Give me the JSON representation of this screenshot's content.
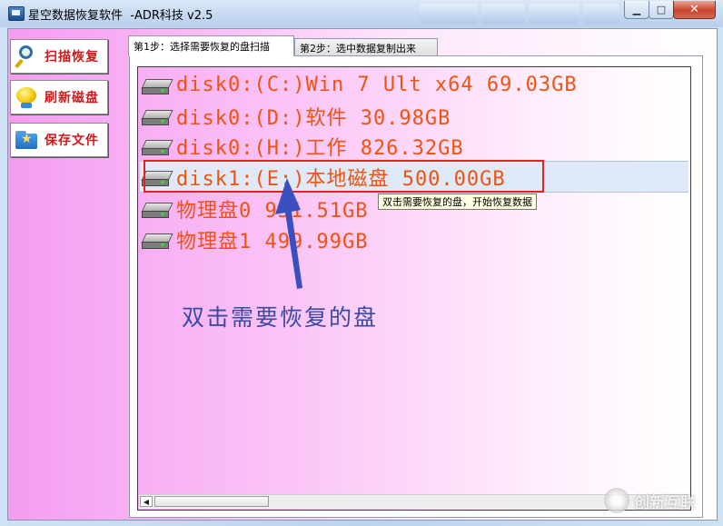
{
  "window": {
    "title": "星空数据恢复软件  -ADR科技 v2.5",
    "controls": {
      "minimize": "▁",
      "maximize": "□",
      "close": "✕"
    }
  },
  "sidebar": {
    "buttons": [
      {
        "label": "扫描恢复",
        "icon": "magnifier-icon"
      },
      {
        "label": "刷新磁盘",
        "icon": "refresh-globe-icon"
      },
      {
        "label": "保存文件",
        "icon": "save-folder-icon"
      }
    ]
  },
  "tabs": [
    {
      "label": "第1步：选择需要恢复的盘扫描",
      "active": true
    },
    {
      "label": "第2步：选中数据复制出来",
      "active": false
    }
  ],
  "disks": [
    {
      "label": "disk0:(C:)Win 7 Ult x64 69.03GB"
    },
    {
      "label": "disk0:(D:)软件 30.98GB"
    },
    {
      "label": "disk0:(H:)工作 826.32GB"
    },
    {
      "label": "disk1:(E:)本地磁盘 500.00GB",
      "selected": true
    },
    {
      "label": "物理盘0 931.51GB"
    },
    {
      "label": "物理盘1 499.99GB"
    }
  ],
  "tooltip": "双击需要恢复的盘，开始恢复数据",
  "annotation": "双击需要恢复的盘",
  "scrollbar": {
    "left_arrow": "◀"
  },
  "watermark": "创新互联",
  "colors": {
    "disk_text": "#f0530f",
    "sidebar_label": "#d3181a",
    "annotation": "#3b4aa3",
    "highlight_box": "#e32121"
  }
}
